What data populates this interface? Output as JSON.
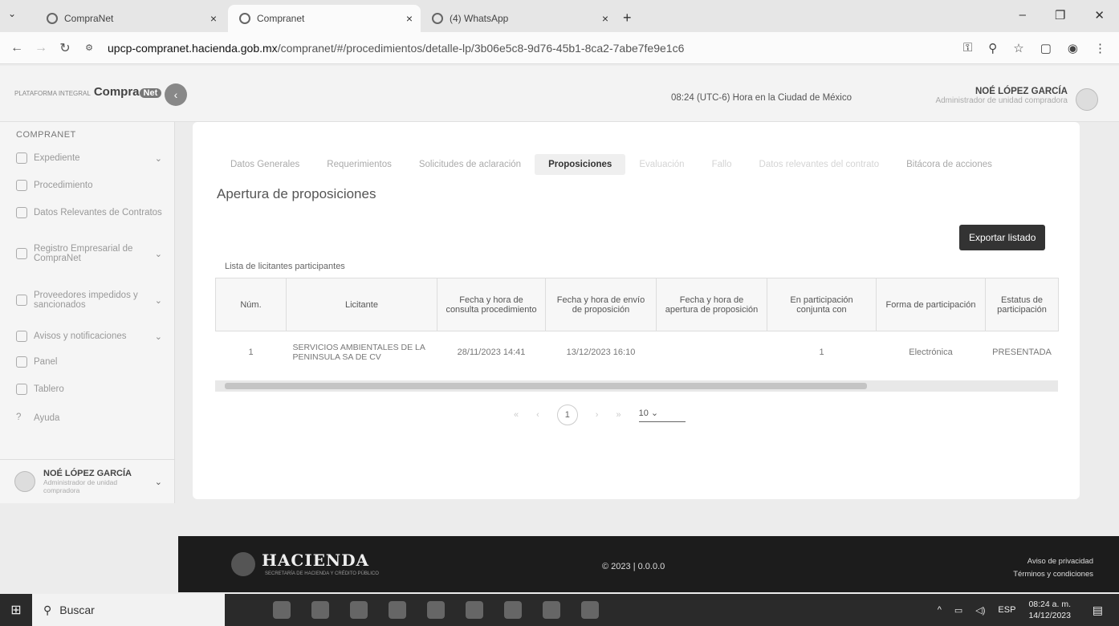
{
  "browser": {
    "tabs": [
      {
        "title": "CompraNet"
      },
      {
        "title": "Compranet"
      },
      {
        "title": "(4) WhatsApp"
      }
    ],
    "url_domain": "upcp-compranet.hacienda.gob.mx",
    "url_path": "/compranet/#/procedimientos/detalle-lp/3b06e5c8-9d76-45b1-8ca2-7abe7fe9e1c6"
  },
  "header": {
    "logo_pre": "PLATAFORMA INTEGRAL",
    "logo_main": "Compra",
    "logo_net": "Net",
    "clock": "08:24 (UTC-6) Hora en la Ciudad de México",
    "user_name": "NOÉ LÓPEZ GARCÍA",
    "user_role": "Administrador de unidad compradora"
  },
  "sidebar": {
    "title": "COMPRANET",
    "items": [
      {
        "label": "Expediente"
      },
      {
        "label": "Procedimiento"
      },
      {
        "label": "Datos Relevantes de Contratos"
      },
      {
        "label": "Registro Empresarial de CompraNet"
      },
      {
        "label": "Proveedores impedidos y sancionados"
      },
      {
        "label": "Avisos y notificaciones"
      },
      {
        "label": "Panel"
      },
      {
        "label": "Tablero"
      },
      {
        "label": "Ayuda"
      }
    ],
    "user_name": "NOÉ LÓPEZ GARCÍA",
    "user_role": "Administrador de unidad compradora"
  },
  "tabs": [
    {
      "label": "Datos Generales"
    },
    {
      "label": "Requerimientos"
    },
    {
      "label": "Solicitudes de aclaración"
    },
    {
      "label": "Proposiciones"
    },
    {
      "label": "Evaluación"
    },
    {
      "label": "Fallo"
    },
    {
      "label": "Datos relevantes del contrato"
    },
    {
      "label": "Bitácora de acciones"
    }
  ],
  "main": {
    "section_title": "Apertura de proposiciones",
    "export_label": "Exportar listado",
    "list_label": "Lista de licitantes participantes",
    "columns": [
      "Núm.",
      "Licitante",
      "Fecha y hora de consulta procedimiento",
      "Fecha y hora de envío de proposición",
      "Fecha y hora de apertura de proposición",
      "En participación conjunta con",
      "Forma de participación",
      "Estatus de participación"
    ],
    "rows": [
      {
        "num": "1",
        "licitante": "SERVICIOS AMBIENTALES DE LA PENINSULA SA DE CV",
        "consulta": "28/11/2023 14:41",
        "envio": "13/12/2023 16:10",
        "apertura": "",
        "conjunta": "1",
        "forma": "Electrónica",
        "estatus": "PRESENTADA"
      }
    ],
    "pager": {
      "first": "«",
      "prev": "‹",
      "current": "1",
      "next": "›",
      "last": "»",
      "per_page": "10"
    }
  },
  "footer": {
    "brand": "HACIENDA",
    "sub": "SECRETARÍA DE HACIENDA Y CRÉDITO PÚBLICO",
    "copy": "© 2023 | 0.0.0.0",
    "privacy": "Aviso de privacidad",
    "terms": "Términos y condiciones"
  },
  "taskbar": {
    "search": "Buscar",
    "lang": "ESP",
    "time": "08:24 a. m.",
    "date": "14/12/2023"
  }
}
